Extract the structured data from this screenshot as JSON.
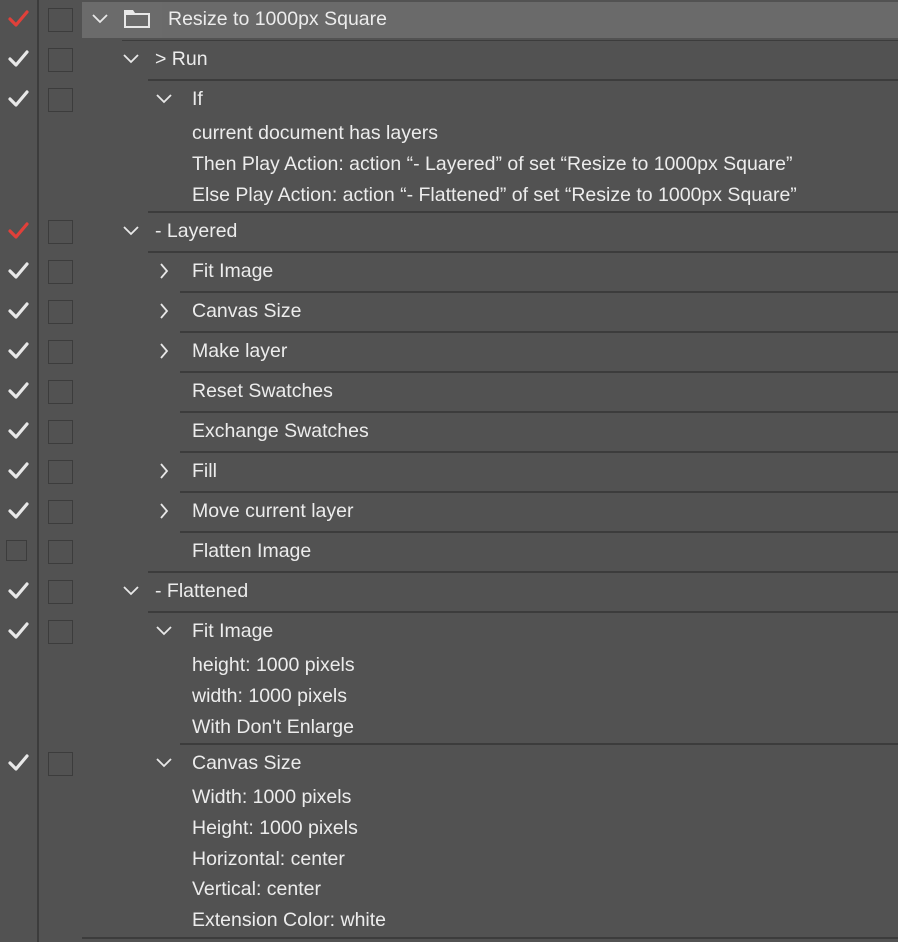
{
  "colors": {
    "panel_bg": "#525252",
    "header_bg": "#6b6b6b",
    "separator": "#3c3c3c",
    "text": "#ececec",
    "check_white": "#e8e8e8",
    "check_red": "#e0403a"
  },
  "set": {
    "name": "Resize to 1000px Square",
    "check": "red",
    "icon": "folder-icon"
  },
  "actions": [
    {
      "name": "> Run",
      "check": "white",
      "steps": [
        {
          "name": "If",
          "check": "white",
          "expanded": true,
          "details": [
            "current document has layers",
            "Then Play Action: action “- Layered” of set “Resize to 1000px Square”",
            "Else Play Action: action “- Flattened” of set “Resize to 1000px Square”"
          ]
        }
      ]
    },
    {
      "name": "- Layered",
      "check": "red",
      "steps": [
        {
          "name": "Fit Image",
          "check": "white",
          "expander": "collapsed"
        },
        {
          "name": "Canvas Size",
          "check": "white",
          "expander": "collapsed"
        },
        {
          "name": "Make layer",
          "check": "white",
          "expander": "collapsed"
        },
        {
          "name": "Reset Swatches",
          "check": "white",
          "expander": "none"
        },
        {
          "name": "Exchange Swatches",
          "check": "white",
          "expander": "none"
        },
        {
          "name": "Fill",
          "check": "white",
          "expander": "collapsed"
        },
        {
          "name": "Move current layer",
          "check": "white",
          "expander": "collapsed"
        },
        {
          "name": "Flatten Image",
          "check": "empty",
          "expander": "none"
        }
      ]
    },
    {
      "name": "- Flattened",
      "check": "white",
      "steps": [
        {
          "name": "Fit Image",
          "check": "white",
          "expanded": true,
          "details": [
            "height: 1000 pixels",
            "width: 1000 pixels",
            "With Don't Enlarge"
          ]
        },
        {
          "name": "Canvas Size",
          "check": "white",
          "expanded": true,
          "details": [
            "Width: 1000 pixels",
            "Height: 1000 pixels",
            "Horizontal: center",
            "Vertical: center",
            "Extension Color: white"
          ]
        }
      ]
    }
  ]
}
